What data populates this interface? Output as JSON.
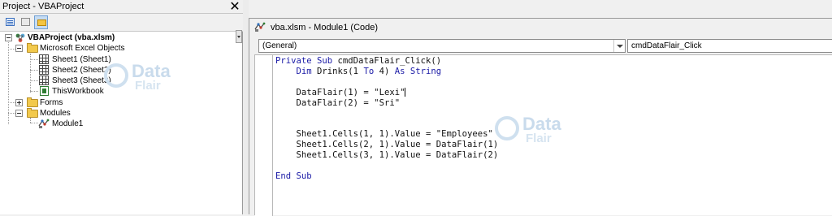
{
  "project_explorer": {
    "title": "Project - VBAProject",
    "close_glyph": "✕",
    "toolbar": [
      "view-code-icon",
      "view-object-icon",
      "toggle-folders-icon"
    ],
    "tree": {
      "project": "VBAProject (vba.xlsm)",
      "excel_objects_folder": "Microsoft Excel Objects",
      "sheets": [
        "Sheet1 (Sheet1)",
        "Sheet2 (Sheet2)",
        "Sheet3 (Sheet3)"
      ],
      "workbook": "ThisWorkbook",
      "forms_folder": "Forms",
      "modules_folder": "Modules",
      "module": "Module1"
    }
  },
  "watermark": {
    "word1": "Data",
    "word2": "Flair"
  },
  "code_window": {
    "title": "vba.xlsm - Module1 (Code)",
    "object_combo": "(General)",
    "procedure_combo": "cmdDataFlair_Click",
    "lines": [
      {
        "indent": "",
        "parts": [
          {
            "t": "Private Sub",
            "kw": true
          },
          {
            "t": " cmdDataFlair_Click()"
          }
        ]
      },
      {
        "indent": "    ",
        "parts": [
          {
            "t": "Dim",
            "kw": true
          },
          {
            "t": " Drinks(1 "
          },
          {
            "t": "To",
            "kw": true
          },
          {
            "t": " 4) "
          },
          {
            "t": "As String",
            "kw": true
          }
        ]
      },
      {
        "indent": "",
        "parts": []
      },
      {
        "indent": "    ",
        "parts": [
          {
            "t": "DataFlair(1) = \"Lexi\""
          }
        ],
        "caret": true
      },
      {
        "indent": "    ",
        "parts": [
          {
            "t": "DataFlair(2) = \"Sri\""
          }
        ]
      },
      {
        "indent": "",
        "parts": []
      },
      {
        "indent": "",
        "parts": []
      },
      {
        "indent": "    ",
        "parts": [
          {
            "t": "Sheet1.Cells(1, 1).Value = \"Employees\""
          }
        ]
      },
      {
        "indent": "    ",
        "parts": [
          {
            "t": "Sheet1.Cells(2, 1).Value = DataFlair(1)"
          }
        ]
      },
      {
        "indent": "    ",
        "parts": [
          {
            "t": "Sheet1.Cells(3, 1).Value = DataFlair(2)"
          }
        ]
      },
      {
        "indent": "",
        "parts": []
      },
      {
        "indent": "",
        "parts": [
          {
            "t": "End Sub",
            "kw": true
          }
        ]
      }
    ]
  },
  "colors": {
    "keyword": "#1a1aa6",
    "folder": "#f2c94c",
    "watermark": "#c9dbec"
  }
}
